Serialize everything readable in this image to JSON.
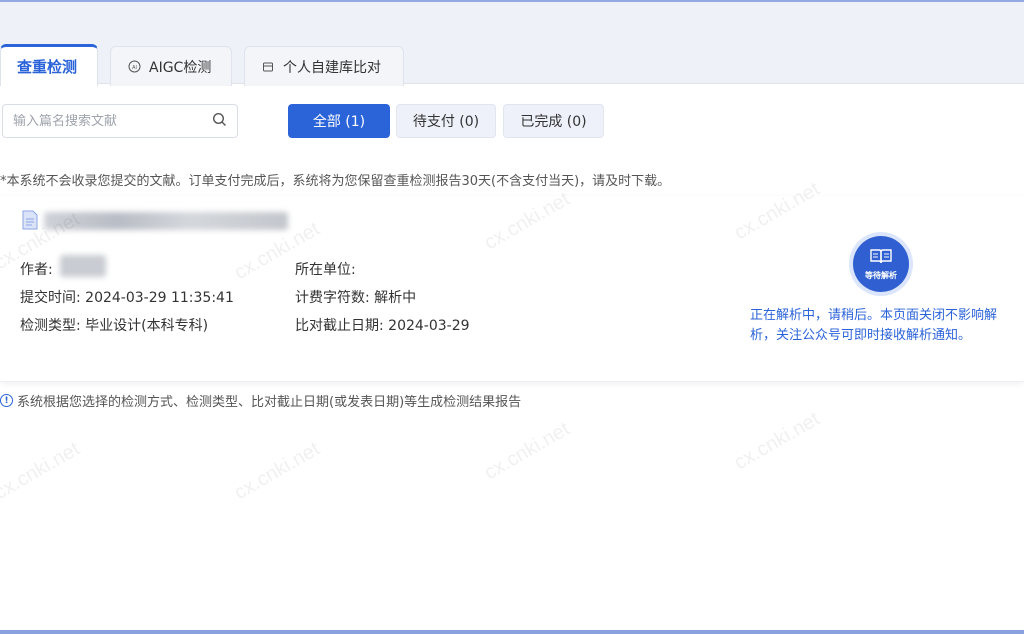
{
  "tabs": [
    {
      "label": "查重检测",
      "icon": "none",
      "active": true
    },
    {
      "label": "AIGC检测",
      "icon": "ai-icon",
      "active": false
    },
    {
      "label": "个人自建库比对",
      "icon": "database-icon",
      "active": false
    }
  ],
  "search": {
    "placeholder": "输入篇名搜索文献",
    "value": ""
  },
  "filters": [
    {
      "label": "全部 (1)",
      "active": true
    },
    {
      "label": "待支付 (0)",
      "active": false
    },
    {
      "label": "已完成 (0)",
      "active": false
    }
  ],
  "notice": "*本系统不会收录您提交的文献。订单支付完成后，系统将为您保留查重检测报告30天(不含支付当天)，请及时下载。",
  "record": {
    "author_label": "作者:",
    "submit_time": "提交时间:  2024-03-29 11:35:41",
    "check_type": "检测类型:  毕业设计(本科专科)",
    "unit_label": "所在单位:",
    "char_count": "计费字符数:  解析中",
    "deadline": "比对截止日期:  2024-03-29",
    "status_badge": "等待解析",
    "status_message": "正在解析中，请稍后。本页面关闭不影响解析，关注公众号可即时接收解析通知。"
  },
  "footer_note": "系统根据您选择的检测方式、检测类型、比对截止日期(或发表日期)等生成检测结果报告",
  "watermark_text": "cx.cnki.net",
  "colors": {
    "accent": "#2b63d9"
  }
}
